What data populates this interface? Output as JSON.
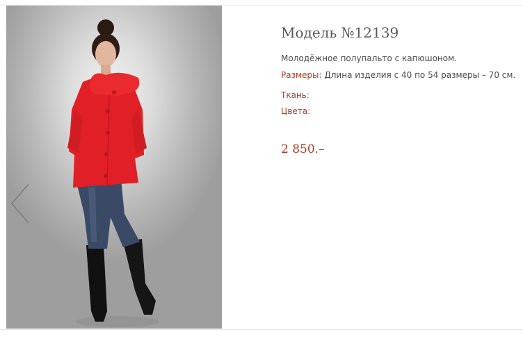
{
  "product": {
    "title": "Модель №12139",
    "description": "Молодёжное полупальто с капюшоном.",
    "sizes_label": "Размеры:",
    "sizes_value": "Длина изделия с 40 по 54 размеры – 70 см.",
    "fabric_label": "Ткань:",
    "fabric_value": "",
    "colors_label": "Цвета:",
    "colors_value": "",
    "price": "2 850.–"
  },
  "gallery": {
    "prev_icon": "chevron-left-icon"
  },
  "colors": {
    "accent": "#b03a24",
    "text": "#4a4a4a",
    "title": "#565656",
    "coat": "#e01f26",
    "jeans": "#3a4a66"
  }
}
